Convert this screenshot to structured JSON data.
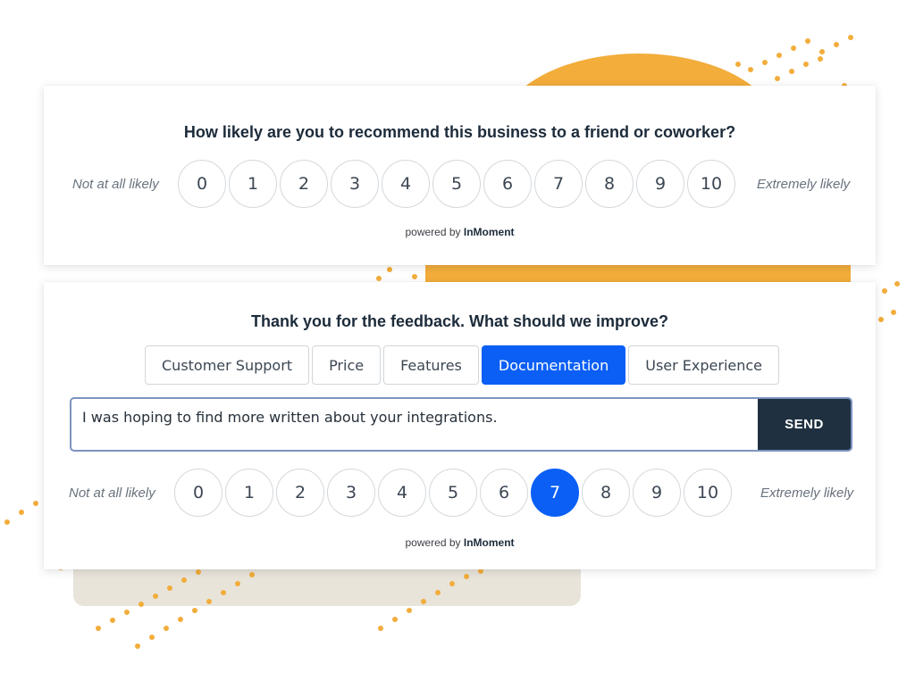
{
  "survey_initial": {
    "question": "How likely are you to recommend this business to a friend or coworker?",
    "low_label": "Not at all likely",
    "high_label": "Extremely likely",
    "scores": [
      "0",
      "1",
      "2",
      "3",
      "4",
      "5",
      "6",
      "7",
      "8",
      "9",
      "10"
    ],
    "powered_prefix": "powered by",
    "powered_brand": "InMoment"
  },
  "survey_followup": {
    "question": "Thank you for the feedback. What should we improve?",
    "categories": [
      "Customer Support",
      "Price",
      "Features",
      "Documentation",
      "User Experience"
    ],
    "selected_category": "Documentation",
    "feedback_text": "I was hoping to find more written about your integrations.",
    "send_label": "SEND",
    "low_label": "Not at all likely",
    "high_label": "Extremely likely",
    "scores": [
      "0",
      "1",
      "2",
      "3",
      "4",
      "5",
      "6",
      "7",
      "8",
      "9",
      "10"
    ],
    "selected_score": "7",
    "powered_prefix": "powered by",
    "powered_brand": "InMoment"
  },
  "colors": {
    "accent": "#0b5ff5",
    "send_button": "#1f3040",
    "decor_orange": "#f2ad3b",
    "decor_beige": "#e8e4da"
  }
}
